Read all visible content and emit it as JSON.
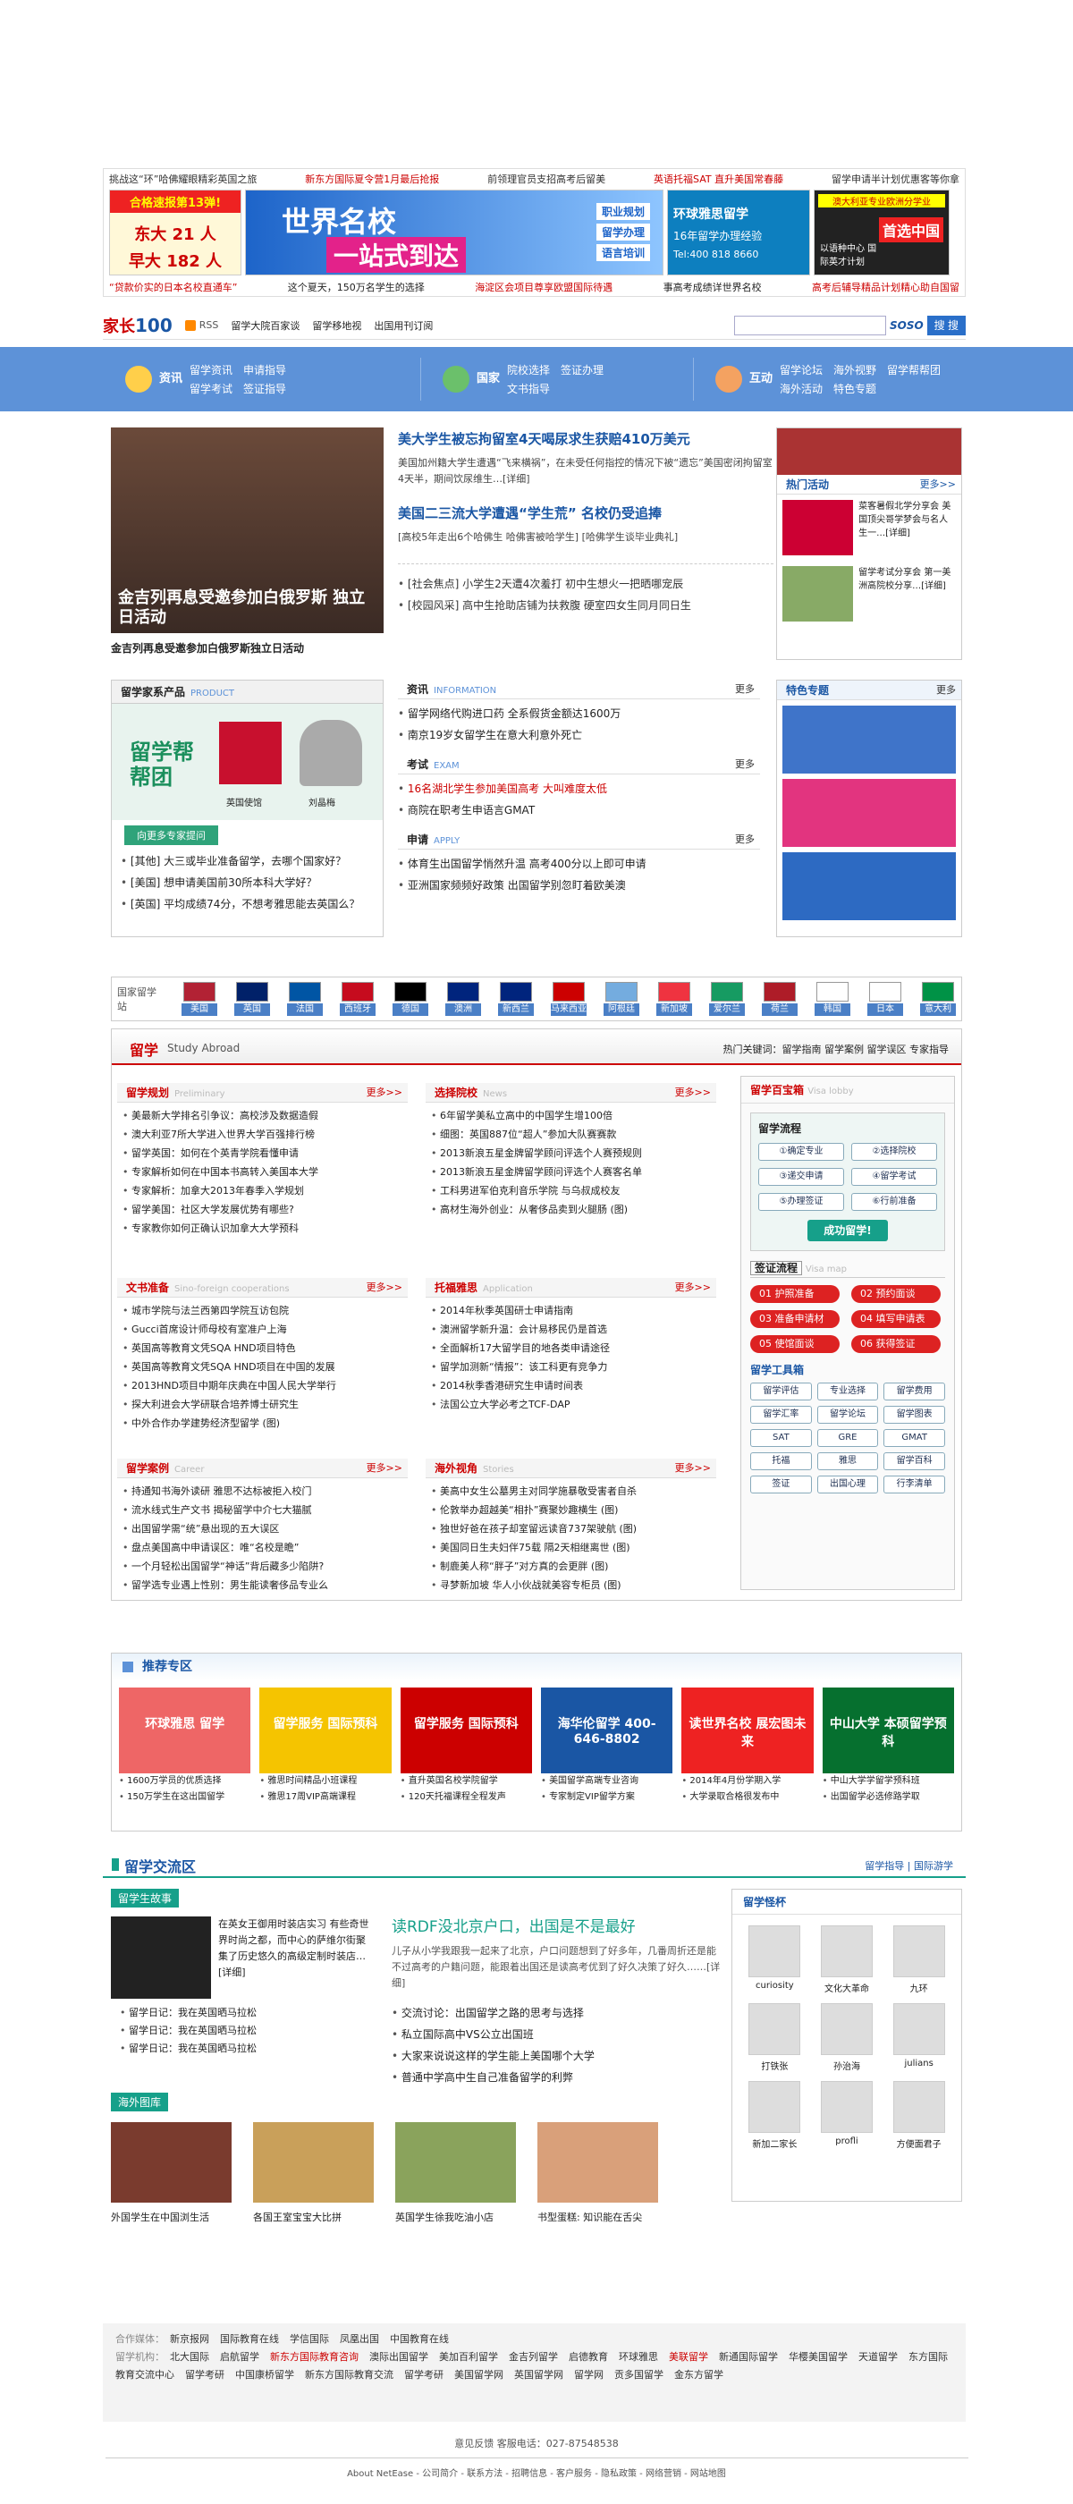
{
  "top_text": [
    "挑战这“环”哈佛耀眼精彩英国之旅",
    "新东方国际夏令营1月最后抢报",
    "前领理官员支招高考后留美",
    "英语托福SAT 直升美国常春藤",
    "留学申请半计划优惠客等你拿"
  ],
  "ad1": {
    "title": "合格速报第13弹!",
    "line1": "东大 21 人",
    "line2": "早大 182 人"
  },
  "ad2": {
    "title": "世界名校",
    "sub": "一站式到达",
    "items": [
      "职业规划",
      "留学办理",
      "语言培训"
    ]
  },
  "ad3": {
    "title": "环球雅思留学",
    "sub": "16年留学办理经验",
    "tel": "Tel:400 818 8660"
  },
  "ad4": {
    "title": "澳大利亚专业欧洲分学业",
    "sub": "首选中国",
    "sub2": "以语种中心 国际英才计划"
  },
  "ad_bottom": [
    "“贷款价实的日本名校直通车”",
    "这个夏天，150万名学生的选择",
    "海淀区会项目尊享欧盟国际待遇",
    "事高考成绩详世界名校",
    "高考后辅导精品计划精心助自国留"
  ],
  "logo": {
    "text": "家长",
    "accent": "100",
    "rss": "RSS",
    "links": [
      "留学大院百家谈",
      "留学移地视",
      "出国用刊订阅"
    ]
  },
  "search": {
    "placeholder": "",
    "button": "搜 搜",
    "brand": "SOSO"
  },
  "nav": [
    {
      "cat": "资讯",
      "links": [
        "留学资讯",
        "申请指导",
        "留学考试",
        "签证指导"
      ]
    },
    {
      "cat": "国家",
      "links": [
        "院校选择",
        "签证办理",
        "文书指导"
      ]
    },
    {
      "cat": "互动",
      "links": [
        "留学论坛",
        "海外视野",
        "留学帮帮团",
        "海外活动",
        "特色专题"
      ]
    }
  ],
  "headline": {
    "caption": "金吉列再息受邀参加白俄罗斯独立日活动",
    "photo_text": "金吉列再息受邀参加白俄罗斯 独立日活动",
    "h1": "美大学生被忘拘留室4天喝尿求生获赔410万美元",
    "p1": "美国加州籍大学生遭遇“飞来横祸”，在未受任何指控的情况下被“遗忘”美国密闭拘留室4天半，期间饮尿维生…[详细]",
    "h2": "美国二三流大学遭遇“学生荒” 名校仍受追捧",
    "p2": "[高校5年走出6个哈佛生 哈佛害被哈学生] [哈佛学生谈毕业典礼]",
    "l1": "[社会焦点] 小学生2天遭4次羞打  初中生想火一把晒哪宠辰",
    "l2": "[校园风采] 高中生抢助店铺为扶救腹 硬室四女生同月同日生"
  },
  "hot": {
    "title": "热门活动",
    "more": "更多>>",
    "items": [
      {
        "text": "菜客暑假北学分享会 美国顶尖哥学梦会与名人生一…[详细]"
      },
      {
        "text": "留学考试分享会 第一美洲高院校分享…[详细]"
      }
    ]
  },
  "product": {
    "title": "留学家系产品",
    "en": "PRODUCT",
    "banner": "留学帮帮团",
    "tags": [
      "英国使馆",
      "刘晶梅"
    ],
    "btn": "向更多专家提问",
    "items": [
      "[其他] 大三或毕业准备留学，去哪个国家好？",
      "[美国] 想申请美国前30所本科大学好？",
      "[英国] 平均成绩74分，不想考雅思能去英国么？"
    ]
  },
  "news": {
    "sections": [
      {
        "title": "资讯",
        "en": "INFORMATION",
        "more": "更多",
        "items": [
          "留学网络代购进口药 全系假货金额达1600万",
          "南京19岁女留学生在意大利意外死亡"
        ]
      },
      {
        "title": "考试",
        "en": "EXAM",
        "more": "更多",
        "items": [
          "16名湖北学生参加美国高考 大叫难度太低",
          "商院在职考生申语言GMAT"
        ]
      },
      {
        "title": "申请",
        "en": "APPLY",
        "more": "更多",
        "items": [
          "体育生出国留学悄然升温 高考400分以上即可申请",
          "亚洲国家频频好政策 出国留学别忽盯着欧美澳"
        ]
      }
    ]
  },
  "special": {
    "title": "特色专题",
    "more": "更多"
  },
  "countries": {
    "label": "国家留学站",
    "list": [
      "美国",
      "英国",
      "法国",
      "西班牙",
      "德国",
      "澳洲",
      "新西兰",
      "马来西亚",
      "阿根廷",
      "新加坡",
      "爱尔兰",
      "荷兰",
      "韩国",
      "日本",
      "意大利"
    ]
  },
  "study_abroad": {
    "title": "留学",
    "en": "Study Abroad",
    "keywords": "热门关键词：留学指南  留学案例  留学误区  专家指导"
  },
  "modules": [
    {
      "title": "留学规划",
      "en": "Preliminary",
      "more": "更多>>",
      "items": [
        "美最新大学排名引争议：高校涉及数据造假",
        "澳大利亚7所大学进入世界大学百强排行榜",
        "留学英国：如何在个英青学院看懂申请",
        "专家解析如何在中国本书高转入美国本大学",
        "专家解析：加拿大2013年春季入学规划",
        "留学美国：社区大学发展优势有哪些?",
        "专家教你如何正确认识加拿大大学预科"
      ]
    },
    {
      "title": "选择院校",
      "en": "News",
      "more": "更多>>",
      "items": [
        "6年留学美私立高中的中国学生增100倍",
        "细图：英国887位“超人”参加大队赛赛款",
        "2013新浪五星金牌留学顾问评选个人赛预规则",
        "2013新浪五星金牌留学顾问评选个人赛客名单",
        "工科男进军伯克利音乐学院  与乌叔成校友",
        "高材生海外创业：从奢侈品卖到火腿肠 (图)"
      ]
    },
    {
      "title": "文书准备",
      "en": "Sino-foreign cooperations",
      "more": "更多>>",
      "items": [
        "城市学院与法兰西第四学院互访包院",
        "Gucci首席设计师母校有室准户上海",
        "英国高等教育文凭SQA HND项目特色",
        "英国高等教育文凭SQA HND项目在中国的发展",
        "2013HND项目中期年庆典在中国人民大学举行",
        "探大利进会大学研联合培养博士研究生",
        "中外合作办学建势经济型留学 (图)"
      ]
    },
    {
      "title": "托福雅思",
      "en": "Application",
      "more": "更多>>",
      "items": [
        "2014年秋季英国研士申请指南",
        "澳洲留学新升温：会计易移民仍是首选",
        "全面解析17大留学目的地各类申请途径",
        "留学加测新“情报”：该工科更有竞争力",
        "2014秋季香港研究生申请时间表",
        "法国公立大学必考之TCF-DAP"
      ]
    },
    {
      "title": "留学案例",
      "en": "Career",
      "more": "更多>>",
      "items": [
        "持通知书海外读研 雅思不达标被拒入校门",
        "流水线式生产文书  揭秘留学中介七大猫腻",
        "出国留学需“统”悬出现的五大误区",
        "盘点美国高中申请误区：唯“名校是瞻”",
        "一个月轻松出国留学“神话”背后藏多少陷阱?",
        "留学选专业遇上性别：男生能读奢侈品专业么"
      ]
    },
    {
      "title": "海外视角",
      "en": "Stories",
      "more": "更多>>",
      "items": [
        "美高中女生公墓男主对同学施暴敬受害者自杀",
        "伦敦举办超越美“相扑”赛聚妙趣横生 (图)",
        "独世好爸在孩子却室留远读音737架驶航 (图)",
        "美国同日生夫妇伴75载  隔2天相继离世 (图)",
        "制鹿美人称“胖子”对方真的会更胖 (图)",
        "寻梦新加坡 华人小伙战就美容专柜员 (图)"
      ]
    }
  ],
  "baodian": {
    "title": "留学百宝箱",
    "en": "Visa lobby",
    "flow_title": "留学流程",
    "steps": [
      "①确定专业",
      "②选择院校",
      "③递交申请",
      "④留学考试",
      "⑤办理签证",
      "⑥行前准备"
    ],
    "success": "成功留学!",
    "visa_title": "签证流程",
    "visa_en": "Visa map",
    "visa": [
      "01 护照准备",
      "02 预约面谈",
      "03 准备申请材料",
      "04 填写申请表",
      "05 使馆面谈",
      "06 获得签证"
    ],
    "tools_title": "留学工具箱",
    "tools": [
      "留学评估",
      "专业选择",
      "留学费用",
      "留学汇率",
      "留学论坛",
      "留学图表",
      "SAT",
      "GRE",
      "GMAT",
      "托福",
      "雅思",
      "留学百科",
      "签证",
      "出国心理",
      "行李清单"
    ]
  },
  "recommend": {
    "title": "推荐专区",
    "items": [
      {
        "ad": "环球雅思 留学",
        "cap1": "1600万学员的优质选择",
        "cap2": "150万学生在这出国留学"
      },
      {
        "ad": "留学服务 国际预科",
        "cap1": "雅思时间精品小班课程",
        "cap2": "雅思17周VIP高端课程"
      },
      {
        "ad": "留学服务 国际预科",
        "cap1": "直升英国名校学院留学",
        "cap2": "120天托福课程全程发声"
      },
      {
        "ad": "海华伦留学 400-646-8802",
        "cap1": "美国留学高端专业咨询",
        "cap2": "专家制定VIP留学方案"
      },
      {
        "ad": "读世界名校 展宏图未来",
        "cap1": "2014年4月份学期入学",
        "cap2": "大学录取合格很发布中"
      },
      {
        "ad": "中山大学 本硕留学预科",
        "cap1": "中山大学学留学预科班",
        "cap2": "出国留学必选修路学取"
      }
    ]
  },
  "exchange": {
    "title": "留学交流区",
    "right": "留学指导 | 国际游学"
  },
  "story": {
    "title": "留学生故事",
    "text": "在英女王御用时装店实习 有些奇世界时尚之都，而中心的萨维尔街聚集了历史悠久的高级定制时装店…[详细]",
    "items": [
      "留学日记：我在英国晒马拉松",
      "留学日记：我在英国晒马拉松",
      "留学日记：我在英国晒马拉松"
    ]
  },
  "feature": {
    "title": "读RDF没北京户口，出国是不是最好",
    "text": "儿子从小学我跟我一起来了北京，户口问题想到了好多年，几番周折还是能不过高考的户籍问题，能跟着出国还是读高考优到了好久决策了好久……[详细]",
    "items": [
      "交流讨论：出国留学之路的思考与选择",
      "私立国际高中VS公立出国班",
      "大家来说说这样的学生能上美国哪个大学",
      "普通中学高中生自己准备留学的利弊"
    ]
  },
  "gallery": {
    "title": "海外图库",
    "items": [
      "外国学生在中国浏生活",
      "各国王室宝宝大比拼",
      "英国学生徐我吃油小店",
      "书型蛋糕: 知识能在舌尖"
    ]
  },
  "avatars": {
    "title": "留学怪杯",
    "items": [
      "curiosity",
      "文化大革命",
      "九环",
      "打铁张",
      "孙治海",
      "julians",
      "新加二家长",
      "profli",
      "方便面君子"
    ]
  },
  "partners": {
    "media_label": "合作媒体：",
    "media": [
      "新京报网",
      "国际教育在线",
      "学信国际",
      "凤凰出国",
      "中国教育在线"
    ],
    "org_label": "留学机构：",
    "orgs": [
      "北大国际",
      "启航留学",
      "新东方国际教育咨询",
      "澳际出国留学",
      "美加百利留学",
      "金吉列留学",
      "启德教育",
      "环球雅思",
      "美联留学",
      "新通国际留学",
      "华樱美国留学",
      "天道留学",
      "东方国际教育交流中心",
      "留学考研",
      "中国康桥留学",
      "新东方国际教育交流",
      "留学考研",
      "美国留学网",
      "英国留学网",
      "留学网",
      "贡多国留学",
      "金东方留学"
    ]
  },
  "footer": {
    "contact": "意见反馈    客服电话：027-87548538",
    "links": "About NetEase - 公司简介 - 联系方法 - 招聘信息 - 客户服务 - 隐私政策 - 网络营销 - 网站地图"
  }
}
